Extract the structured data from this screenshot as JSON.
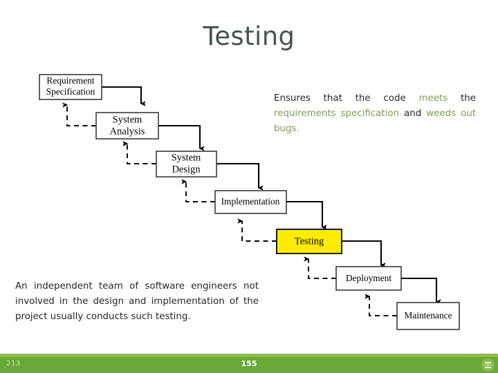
{
  "slide": {
    "title": "Testing"
  },
  "diagram": {
    "name": "waterfall-model-diagram",
    "boxes": [
      {
        "id": "requirement-specification",
        "lines": [
          "Requirement",
          "Specification"
        ],
        "highlight": false
      },
      {
        "id": "system-analysis",
        "lines": [
          "System",
          "Analysis"
        ],
        "highlight": false
      },
      {
        "id": "system-design",
        "lines": [
          "System",
          "Design"
        ],
        "highlight": false
      },
      {
        "id": "implementation",
        "lines": [
          "Implementation"
        ],
        "highlight": false
      },
      {
        "id": "testing",
        "lines": [
          "Testing"
        ],
        "highlight": true
      },
      {
        "id": "deployment",
        "lines": [
          "Deployment"
        ],
        "highlight": false
      },
      {
        "id": "maintenance",
        "lines": [
          "Maintenance"
        ],
        "highlight": false
      }
    ]
  },
  "description_right": {
    "segments": [
      {
        "text": "Ensures that the code ",
        "accent": false
      },
      {
        "text": "meets",
        "accent": true
      },
      {
        "text": " the ",
        "accent": false
      },
      {
        "text": "requirements specification",
        "accent": true
      },
      {
        "text": " and ",
        "accent": false
      },
      {
        "text": "weeds out bugs.",
        "accent": true
      }
    ]
  },
  "description_left": {
    "text": "An independent team of software engineers not involved in the design and implementation of the project usually conducts such testing."
  },
  "footer": {
    "left_number": "213",
    "center_number": "155",
    "menu_icon": "hamburger-menu-icon"
  },
  "colors": {
    "title": "#47544c",
    "accent_green": "#7c9b5a",
    "footer_bar": "#69a937",
    "footer_stripe": "#8cc03f",
    "highlight_box": "#fdec01"
  }
}
